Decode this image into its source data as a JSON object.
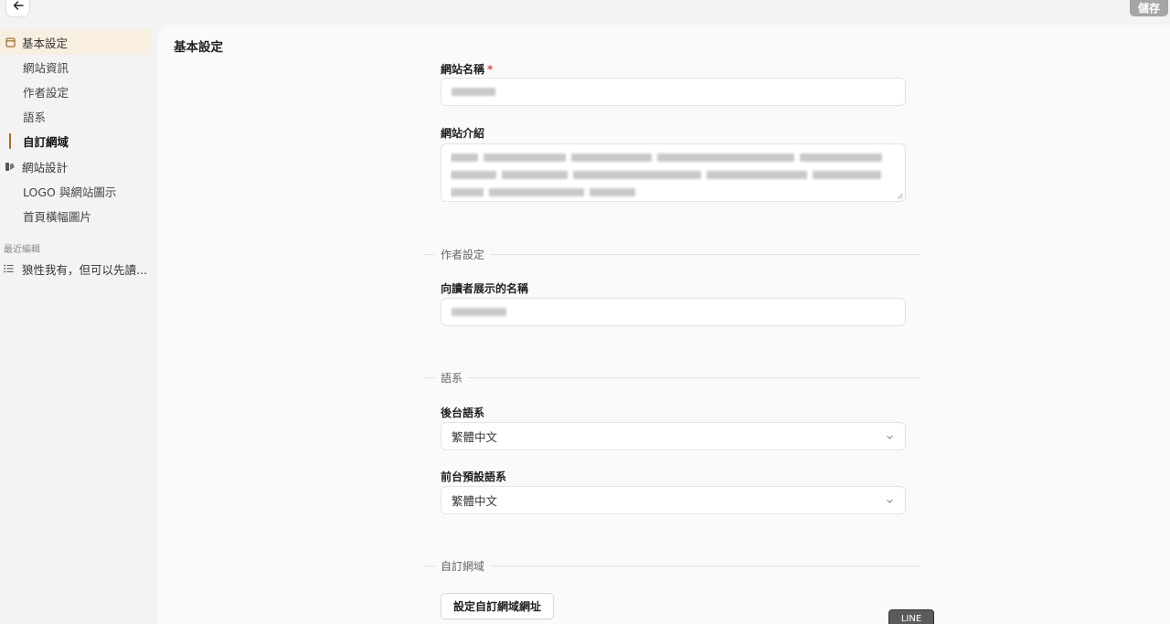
{
  "header": {
    "back_icon": "arrow-left-icon",
    "save_label": "儲存"
  },
  "sidebar": {
    "groups": [
      {
        "label": "基本設定",
        "icon": "window-icon",
        "items": [
          "網站資訊",
          "作者設定",
          "語系",
          "自訂網域"
        ]
      },
      {
        "label": "網站設計",
        "icon": "palette-icon",
        "items": [
          "LOGO 與網站圖示",
          "首頁橫幅圖片"
        ]
      }
    ],
    "recent_title": "最近編輯",
    "recent_items": [
      {
        "label": "狼性我有，但可以先讀...",
        "icon": "list-icon"
      }
    ]
  },
  "main": {
    "title": "基本設定",
    "site_name": {
      "label": "網站名稱",
      "required_mark": "*"
    },
    "site_intro": {
      "label": "網站介紹"
    },
    "author_section": "作者設定",
    "display_name": {
      "label": "向讀者展示的名稱"
    },
    "lang_section": "語系",
    "backend_lang": {
      "label": "後台語系",
      "value": "繁體中文"
    },
    "frontend_lang": {
      "label": "前台預設語系",
      "value": "繁體中文"
    },
    "domain_section": "自訂網域",
    "domain_button": "設定自訂網域網址"
  },
  "overlay": {
    "line_badge": "LINE"
  },
  "colors": {
    "accent": "#a0702c",
    "active_bg": "#f8efe1",
    "save_button_bg": "#a5a5a5",
    "required": "#d65050"
  }
}
